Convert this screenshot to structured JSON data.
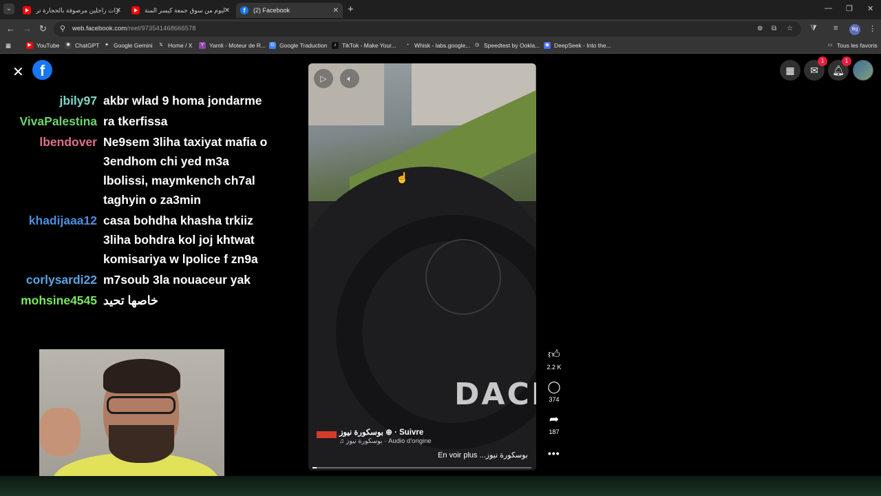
{
  "browser": {
    "tabs": [
      {
        "label": "ممرات راجلين مرصوفة بالحجارة تر",
        "icon": "youtube-icon"
      },
      {
        "label": "ليوم من سوق جمعة كيسر المنة -",
        "icon": "youtube-icon"
      },
      {
        "label": "(2) Facebook",
        "icon": "facebook-icon",
        "active": true
      }
    ],
    "new_tab": "+",
    "window": {
      "minimize": "—",
      "restore": "❐",
      "close": "✕"
    },
    "url_host": "web.facebook.com",
    "url_path": "/reel/973541468666578",
    "bookmarks": [
      {
        "label": "YouTube",
        "color": "#ff0000",
        "glyph": "▶"
      },
      {
        "label": "ChatGPT",
        "color": "#444444",
        "glyph": "✺"
      },
      {
        "label": "Google Gemini",
        "color": "#353535",
        "glyph": "✦"
      },
      {
        "label": "Home / X",
        "color": "#353535",
        "glyph": "𝕏"
      },
      {
        "label": "Yamli - Moteur de R...",
        "color": "#8e44ad",
        "glyph": "Y"
      },
      {
        "label": "Google Traduction",
        "color": "#4285f4",
        "glyph": "G"
      },
      {
        "label": "TikTok - Make Your...",
        "color": "#111111",
        "glyph": "♪"
      },
      {
        "label": "Whisk - labs.google...",
        "color": "#353535",
        "glyph": "◔"
      },
      {
        "label": "Speedtest by Ookla...",
        "color": "#353535",
        "glyph": "◷"
      },
      {
        "label": "DeepSeek - Into the...",
        "color": "#4d6bfe",
        "glyph": "◉"
      }
    ],
    "all_bookmarks": "Tous les favoris",
    "profile_initials": "Bg"
  },
  "chat": [
    {
      "user": "jbily97",
      "color": "#7dd8c8",
      "text": "akbr wlad 9 homa jondarme"
    },
    {
      "user": "VivaPalestina",
      "color": "#6ed46e",
      "text": "ra tkerfissa"
    },
    {
      "user": "lbendover",
      "color": "#e06f8b",
      "text": "Ne9sem 3liha taxiyat mafia o 3endhom chi yed m3a lbolissi, maymkench ch7al taghyin o za3min"
    },
    {
      "user": "khadijaaa12",
      "color": "#4e8fe0",
      "text": "casa bohdha khasha trkiiz 3liha bohdra kol joj khtwat komisariya w lpolice f zn9a"
    },
    {
      "user": "corlysardi22",
      "color": "#5aa6e6",
      "text": "m7soub 3la nouaceur yak"
    },
    {
      "user": "mohsine4545",
      "color": "#7be85e",
      "text": "خاصها تحيد"
    }
  ],
  "reel": {
    "channel": "بوسكورة نيوز",
    "follow": "· Suivre",
    "audio_name": "بوسكورة نيوز",
    "audio_label": "· Audio d'origine",
    "description": "En voir plus ...بوسكورة نيوز",
    "progress": 0.02,
    "car_logo": "DACIA",
    "likes": "2.2 K",
    "comments": "374",
    "shares": "187"
  },
  "header": {
    "messenger_badge": "1",
    "notifications_badge": "1"
  }
}
